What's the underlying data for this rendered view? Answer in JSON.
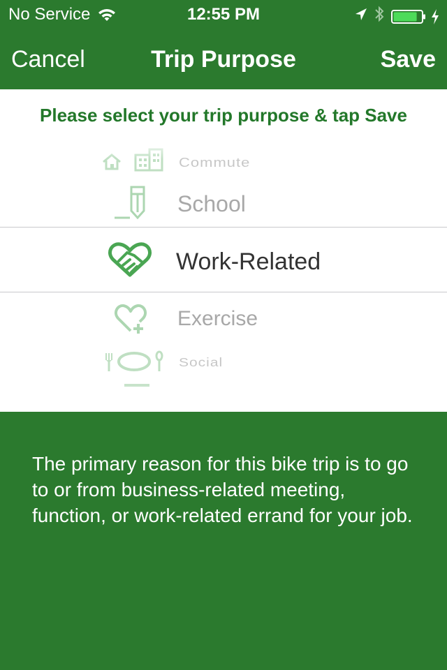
{
  "status_bar": {
    "carrier": "No Service",
    "time": "12:55 PM",
    "battery_level": 0.85
  },
  "nav": {
    "cancel_label": "Cancel",
    "title": "Trip Purpose",
    "save_label": "Save"
  },
  "instruction": "Please select your trip purpose & tap Save",
  "picker": {
    "items": [
      {
        "label": "Commute",
        "icon": "commute-icon"
      },
      {
        "label": "School",
        "icon": "school-icon"
      },
      {
        "label": "Work-Related",
        "icon": "work-related-icon"
      },
      {
        "label": "Exercise",
        "icon": "exercise-icon"
      },
      {
        "label": "Social",
        "icon": "social-icon"
      }
    ],
    "selected_index": 2
  },
  "description": "The primary reason for this bike trip is to go to or from business-related meeting, function, or work-related errand for your job.",
  "colors": {
    "brand_green": "#2b7a2e",
    "accent_green": "#4aa653",
    "selected_text": "#333333",
    "unselected_text": "#a8a8a8"
  }
}
